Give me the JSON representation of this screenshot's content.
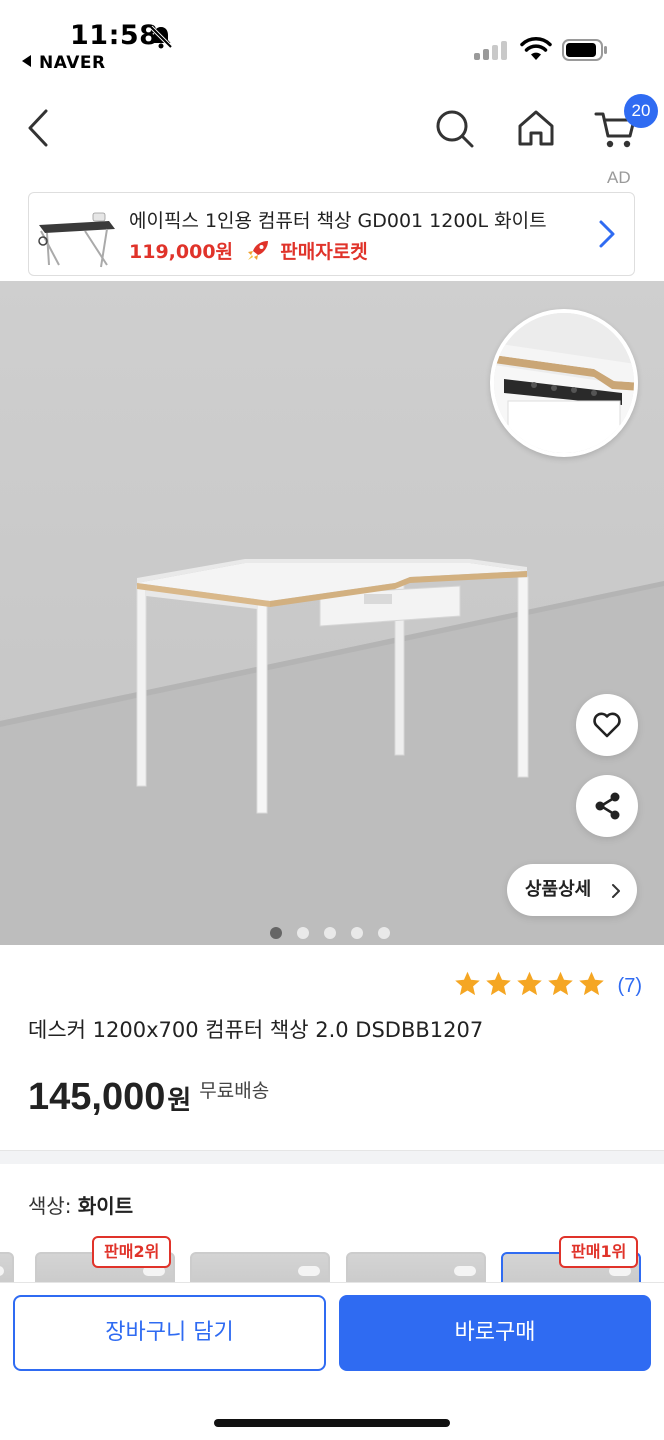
{
  "status_bar": {
    "time": "11:58",
    "back_app": "NAVER",
    "icons": [
      "bell-off-icon",
      "signal-icon",
      "wifi-icon",
      "battery-icon"
    ]
  },
  "nav": {
    "cart_count": "20",
    "icons": [
      "back-icon",
      "search-icon",
      "home-icon",
      "cart-icon"
    ]
  },
  "ad": {
    "label": "AD",
    "title": "에이픽스 1인용 컴퓨터 책상 GD001 1200L 화이트",
    "price": "119,000원",
    "rocket_label": "판매자로켓"
  },
  "hero": {
    "detail_button": "상품상세",
    "slide_count": 5,
    "active_slide": 1
  },
  "product": {
    "rating_stars": 5,
    "review_count": "(7)",
    "title": "데스커 1200x700 컴퓨터 책상 2.0 DSDBB1207",
    "price": "145,000",
    "price_unit": "원",
    "shipping": "무료배송"
  },
  "option": {
    "label": "색상:",
    "value": "화이트",
    "badges": [
      "판매2위",
      "판매1위"
    ]
  },
  "actions": {
    "cart_button": "장바구니 담기",
    "buy_button": "바로구매"
  },
  "colors": {
    "accent": "#2f6bf2",
    "sale_red": "#e0332a",
    "star": "#f5a623"
  }
}
